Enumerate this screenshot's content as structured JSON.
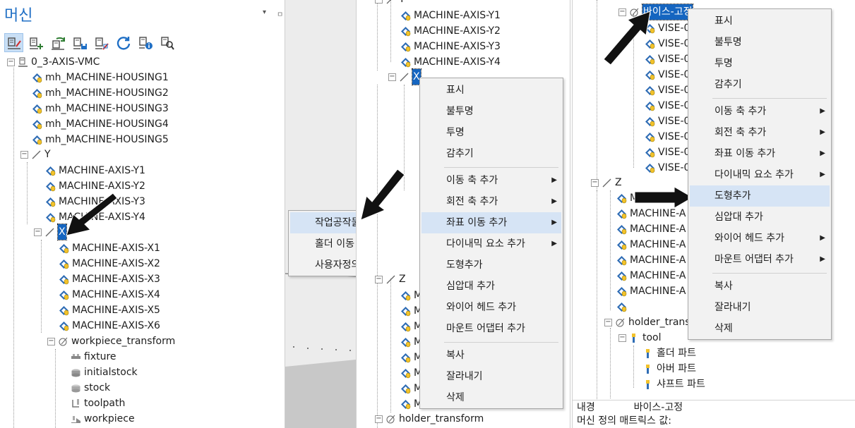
{
  "panel_left": {
    "title": "머신",
    "pin_label": "▾",
    "pin2_label": "ㅁ",
    "toolbar_icons": [
      "edit-machine-icon",
      "add-component-icon",
      "reload-icon",
      "save-icon",
      "edit-properties-icon",
      "refresh-icon",
      "info-icon",
      "search-icon"
    ],
    "tree": {
      "root": "0_3-AXIS-VMC",
      "housing": [
        "mh_MACHINE-HOUSING1",
        "mh_MACHINE-HOUSING2",
        "mh_MACHINE-HOUSING3",
        "mh_MACHINE-HOUSING4",
        "mh_MACHINE-HOUSING5"
      ],
      "axis_y": "Y",
      "y_items": [
        "MACHINE-AXIS-Y1",
        "MACHINE-AXIS-Y2",
        "MACHINE-AXIS-Y3",
        "MACHINE-AXIS-Y4"
      ],
      "axis_x": "X",
      "x_items": [
        "MACHINE-AXIS-X1",
        "MACHINE-AXIS-X2",
        "MACHINE-AXIS-X3",
        "MACHINE-AXIS-X4",
        "MACHINE-AXIS-X5",
        "MACHINE-AXIS-X6"
      ],
      "workpiece_transform": "workpiece_transform",
      "wp_items": [
        "fixture",
        "initialstock",
        "stock",
        "toolpath",
        "workpiece"
      ]
    }
  },
  "submenu_left": {
    "items": [
      "작업공작물 이동",
      "홀더 이동",
      "사용자정의"
    ]
  },
  "panel_middle": {
    "tree_top": "Y",
    "y_items": [
      "MACHINE-AXIS-Y1",
      "MACHINE-AXIS-Y2",
      "MACHINE-AXIS-Y3",
      "MACHINE-AXIS-Y4"
    ],
    "axis_x": "X",
    "axis_z": "Z",
    "z_partial": [
      "M",
      "M",
      "M",
      "M",
      "M",
      "M",
      "M",
      "M"
    ],
    "holder_transform": "holder_transform",
    "context_menu": {
      "items": [
        "표시",
        "불투명",
        "투명",
        "감추기",
        "이동 축 추가",
        "회전 축 추가",
        "좌표 이동 추가",
        "다이내믹 요소 추가",
        "도형추가",
        "심압대 추가",
        "와이어 헤드 추가",
        "마운트 어댑터 추가",
        "복사",
        "잘라내기",
        "삭제"
      ]
    }
  },
  "panel_right": {
    "vise_header": "바이스-고정",
    "vise_items": [
      "VISE-0",
      "VISE-0",
      "VISE-0",
      "VISE-0",
      "VISE-0",
      "VISE-0",
      "VISE-0",
      "VISE-0",
      "VISE-0",
      "VISE-0"
    ],
    "axis_z": "Z",
    "z_items": [
      "MACHINE-A",
      "MACHINE-A",
      "MACHINE-A",
      "MACHINE-A",
      "MACHINE-A",
      "MACHINE-A",
      "MACHINE-A"
    ],
    "holder_transform": "holder_trans",
    "tool": "tool",
    "tool_items": [
      "홀더 파트",
      "아버 파트",
      "샤프트 파트"
    ],
    "context_menu": {
      "items": [
        "표시",
        "불투명",
        "투명",
        "감추기",
        "이동 축 추가",
        "회전 축 추가",
        "좌표 이동 추가",
        "다이내믹 요소 추가",
        "도형추가",
        "심압대 추가",
        "와이어 헤드 추가",
        "마운트 어댑터 추가",
        "복사",
        "잘라내기",
        "삭제"
      ]
    },
    "status": {
      "label1": "내경",
      "value1": "바이스-고정",
      "label2": "머신 정의 매트릭스 값:"
    }
  },
  "colors": {
    "title_blue": "#1f6fc5",
    "selection_blue": "#1565c0",
    "menu_highlight": "#d6e4f5",
    "menu_bg": "#f2f2f2",
    "axis_icon_blue": "#2f6db5",
    "axis_icon_yellow": "#f2c22b"
  }
}
